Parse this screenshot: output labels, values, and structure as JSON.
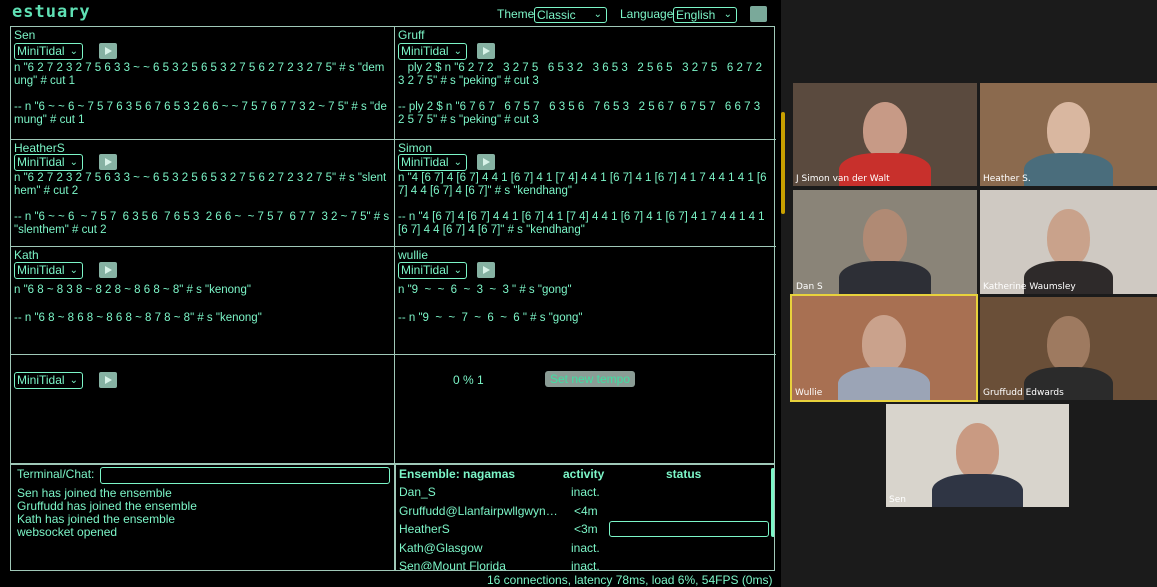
{
  "app": {
    "logo": "estuary",
    "theme_label": "Theme",
    "theme_value": "Classic",
    "language_label": "Language",
    "language_value": "English"
  },
  "cells": [
    {
      "name": "Sen",
      "engine": "MiniTidal",
      "code": "n \"6 2 7 2 3 2 7 5 6 3 3 ~ ~ 6 5 3 2 5 6 5 3 2 7 5 6 2 7 2 3 2 7 5\" # s \"demung\" # cut 1\n\n-- n \"6 ~ ~ 6 ~ 7 5 7 6 3 5 6 7 6 5 3 2 6 6 ~ ~ 7 5 7 6 7 7 3 2 ~ 7 5\" # s \"demung\" # cut 1"
    },
    {
      "name": "Gruff",
      "engine": "MiniTidal",
      "code": "   ply 2 $ n \"6 2 7 2   3 2 7 5   6 5 3 2   3 6 5 3   2 5 6 5   3 2 7 5   6 2 7 2   3 2 7 5\" # s \"peking\" # cut 3\n\n-- ply 2 $ n \"6 7 6 7   6 7 5 7   6 3 5 6   7 6 5 3   2 5 6 7  6 7 5 7   6 6 7 3   2 5 7 5\" # s \"peking\" # cut 3"
    },
    {
      "name": "HeatherS",
      "engine": "MiniTidal",
      "code": "n \"6 2 7 2 3 2 7 5 6 3 3 ~ ~ 6 5 3 2 5 6 5 3 2 7 5 6 2 7 2 3 2 7 5\" # s \"slenthem\" # cut 2\n\n-- n \"6 ~ ~ 6  ~ 7 5 7  6 3 5 6  7 6 5 3  2 6 6 ~  ~ 7 5 7  6 7 7  3 2 ~ 7 5\" # s \"slenthem\" # cut 2"
    },
    {
      "name": "Simon",
      "engine": "MiniTidal",
      "code": "n \"4 [6 7] 4 [6 7] 4 4 1 [6 7] 4 1 [7 4] 4 4 1 [6 7] 4 1 [6 7] 4 1 7 4 4 1 4 1 [6 7] 4 4 [6 7] 4 [6 7]\" # s \"kendhang\"\n\n-- n \"4 [6 7] 4 [6 7] 4 4 1 [6 7] 4 1 [7 4] 4 4 1 [6 7] 4 1 [6 7] 4 1 7 4 4 1 4 1 [6 7] 4 4 [6 7] 4 [6 7]\" # s \"kendhang\""
    },
    {
      "name": "Kath",
      "engine": "MiniTidal",
      "code": "n \"6 8 ~ 8 3 8 ~ 8 2 8 ~ 8 6 8 ~ 8\" # s \"kenong\"\n\n-- n \"6 8 ~ 8 6 8 ~ 8 6 8 ~ 8 7 8 ~ 8\" # s \"kenong\""
    },
    {
      "name": "wullie",
      "engine": "MiniTidal",
      "code": "n \"9  ~  ~  6  ~  3  ~  3 \" # s \"gong\"\n\n-- n \"9  ~  ~  7  ~  6  ~  6 \" # s \"gong\""
    },
    {
      "name": "",
      "engine": "MiniTidal",
      "code": ""
    }
  ],
  "tempo": {
    "text": "0 % 1",
    "button": "Set new tempo"
  },
  "terminal": {
    "label": "Terminal/Chat:",
    "messages": [
      "Sen has joined the ensemble",
      "Gruffudd has joined the ensemble",
      "Kath has joined the ensemble",
      "websocket opened"
    ]
  },
  "ensemble": {
    "title": "Ensemble: nagamas",
    "col_activity": "activity",
    "col_status": "status",
    "rows": [
      {
        "name": "Dan_S",
        "activity": "inact."
      },
      {
        "name": "Gruffudd@Llanfairpwllgwyn…",
        "activity": "<4m"
      },
      {
        "name": "HeatherS",
        "activity": "<3m"
      },
      {
        "name": "Kath@Glasgow",
        "activity": "inact."
      },
      {
        "name": "Sen@Mount Florida",
        "activity": "inact."
      }
    ]
  },
  "statusline": "16 connections, latency 78ms, load 6%, 54FPS (0ms)",
  "video": {
    "participants": [
      {
        "name": "J Simon van der Walt",
        "bg": "#5a4a3e",
        "shirt": "#c8302c",
        "skin": "#c79a86"
      },
      {
        "name": "Heather S.",
        "bg": "#8b6a4e",
        "shirt": "#4a6d7c",
        "skin": "#d9b7a0"
      },
      {
        "name": "Dan S",
        "bg": "#8a8478",
        "shirt": "#2d2f36",
        "skin": "#b08a74"
      },
      {
        "name": "Katherine Waumsley",
        "bg": "#cfc9c2",
        "shirt": "#2e2a2a",
        "skin": "#c9a28b"
      },
      {
        "name": "Wullie",
        "bg": "#a87052",
        "shirt": "#9ba4b6",
        "skin": "#caa28c"
      },
      {
        "name": "Gruffudd Edwards",
        "bg": "#6a4f38",
        "shirt": "#2b2b2b",
        "skin": "#9e7a60"
      },
      {
        "name": "Sen",
        "bg": "#d8d4cc",
        "shirt": "#2f3544",
        "skin": "#c99a82"
      }
    ]
  }
}
